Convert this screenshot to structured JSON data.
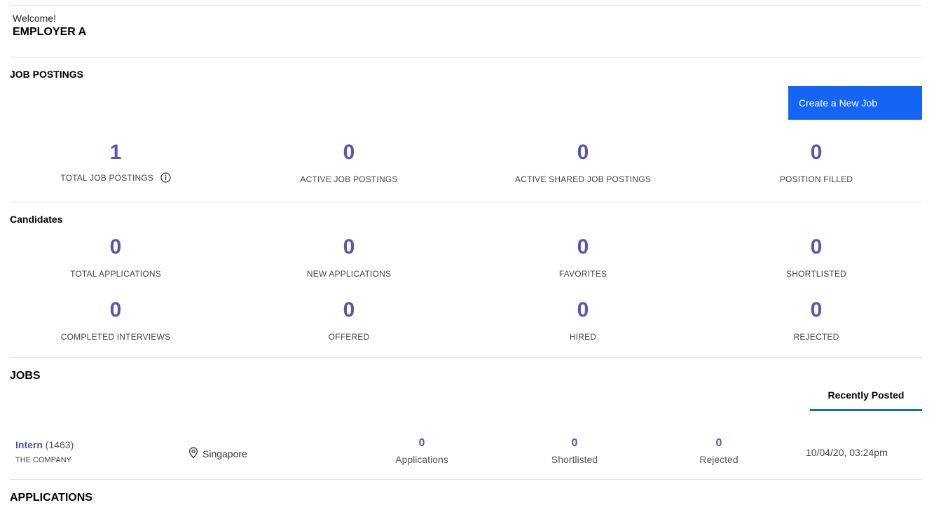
{
  "header": {
    "welcome": "Welcome!",
    "employer_name": "EMPLOYER A"
  },
  "job_postings": {
    "title": "JOB POSTINGS",
    "create_button": "Create a New Job",
    "stats": [
      {
        "value": "1",
        "label": "TOTAL JOB POSTINGS",
        "icon": "info-icon"
      },
      {
        "value": "0",
        "label": "ACTIVE JOB POSTINGS"
      },
      {
        "value": "0",
        "label": "ACTIVE SHARED JOB POSTINGS"
      },
      {
        "value": "0",
        "label": "POSITION FILLED"
      }
    ]
  },
  "candidates": {
    "title": "Candidates",
    "stats": [
      {
        "value": "0",
        "label": "TOTAL APPLICATIONS"
      },
      {
        "value": "0",
        "label": "NEW APPLICATIONS"
      },
      {
        "value": "0",
        "label": "FAVORITES"
      },
      {
        "value": "0",
        "label": "SHORTLISTED"
      },
      {
        "value": "0",
        "label": "COMPLETED INTERVIEWS"
      },
      {
        "value": "0",
        "label": "OFFERED"
      },
      {
        "value": "0",
        "label": "HIRED"
      },
      {
        "value": "0",
        "label": "REJECTED"
      }
    ]
  },
  "jobs": {
    "title": "JOBS",
    "tab": "Recently Posted",
    "rows": [
      {
        "name": "Intern",
        "id": "(1463)",
        "company": "THE COMPANY",
        "location": "Singapore",
        "location_icon": "map-pin-icon",
        "applications": "0",
        "applications_label": "Applications",
        "shortlisted": "0",
        "shortlisted_label": "Shortlisted",
        "rejected": "0",
        "rejected_label": "Rejected",
        "posted": "10/04/20, 03:24pm"
      }
    ]
  },
  "applications": {
    "title": "APPLICATIONS"
  },
  "colors": {
    "accent": "#1565f5",
    "stat_number": "#5558b0",
    "divider": "#e3e3e3"
  }
}
